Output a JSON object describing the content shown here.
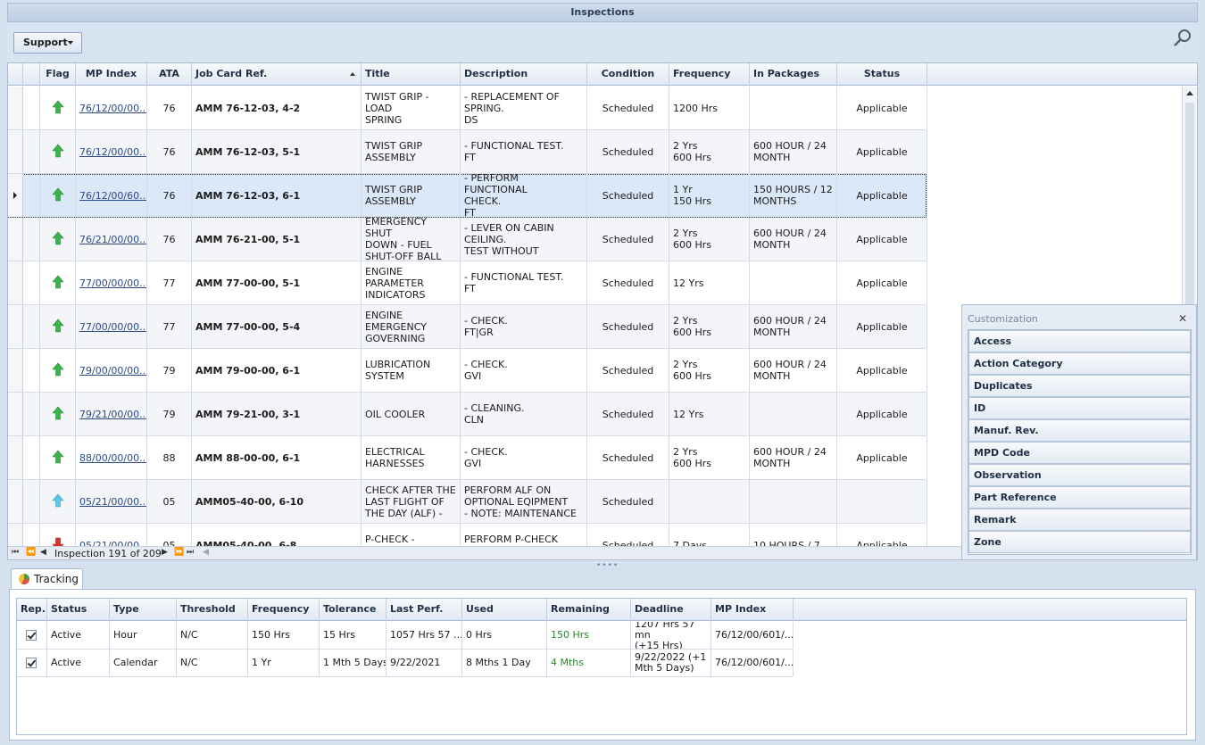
{
  "window": {
    "title": "Inspections"
  },
  "toolbar": {
    "support_label": "Support"
  },
  "grid": {
    "columns": [
      "Flag",
      "MP Index",
      "ATA",
      "Job Card Ref.",
      "Title",
      "Description",
      "Condition",
      "Frequency",
      "In Packages",
      "Status"
    ],
    "rows": [
      {
        "flag": "up-green",
        "mp_index": "76/12/00/00...",
        "ata": "76",
        "job_card": "AMM 76-12-03, 4-2",
        "title": "TWIST GRIP - LOAD\nSPRING",
        "description": "- REPLACEMENT OF\nSPRING.\nDS",
        "condition": "Scheduled",
        "frequency": "1200 Hrs",
        "packages": "",
        "status": "Applicable"
      },
      {
        "flag": "up-green",
        "mp_index": "76/12/00/00...",
        "ata": "76",
        "job_card": "AMM 76-12-03, 5-1",
        "title": "TWIST GRIP\nASSEMBLY",
        "description": "- FUNCTIONAL TEST.\nFT",
        "condition": "Scheduled",
        "frequency": "2 Yrs\n600 Hrs",
        "packages": "600 HOUR / 24\nMONTH",
        "status": "Applicable"
      },
      {
        "flag": "up-green",
        "mp_index": "76/12/00/60...",
        "ata": "76",
        "job_card": "AMM 76-12-03, 6-1",
        "title": "TWIST GRIP\nASSEMBLY",
        "description": "- PERFORM FUNCTIONAL\nCHECK.\nFT",
        "condition": "Scheduled",
        "frequency": "1 Yr\n150 Hrs",
        "packages": "150 HOURS / 12\nMONTHS",
        "status": "Applicable"
      },
      {
        "flag": "up-green",
        "mp_index": "76/21/00/00...",
        "ata": "76",
        "job_card": "AMM 76-21-00, 5-1",
        "title": "EMERGENCY SHUT\nDOWN - FUEL\nSHUT-OFF BALL",
        "description": "- LEVER ON CABIN\nCEILING.\nTEST WITHOUT",
        "condition": "Scheduled",
        "frequency": "2 Yrs\n600 Hrs",
        "packages": "600 HOUR / 24\nMONTH",
        "status": "Applicable"
      },
      {
        "flag": "up-green",
        "mp_index": "77/00/00/00...",
        "ata": "77",
        "job_card": "AMM 77-00-00, 5-1",
        "title": "ENGINE\nPARAMETER\nINDICATORS",
        "description": "- FUNCTIONAL TEST.\nFT",
        "condition": "Scheduled",
        "frequency": "12 Yrs",
        "packages": "",
        "status": "Applicable"
      },
      {
        "flag": "up-green",
        "mp_index": "77/00/00/00...",
        "ata": "77",
        "job_card": "AMM 77-00-00, 5-4",
        "title": "ENGINE\nEMERGENCY\nGOVERNING",
        "description": "- CHECK.\nFT|GR",
        "condition": "Scheduled",
        "frequency": "2 Yrs\n600 Hrs",
        "packages": "600 HOUR / 24\nMONTH",
        "status": "Applicable"
      },
      {
        "flag": "up-green",
        "mp_index": "79/00/00/00...",
        "ata": "79",
        "job_card": "AMM 79-00-00, 6-1",
        "title": "LUBRICATION\nSYSTEM",
        "description": "- CHECK.\nGVI",
        "condition": "Scheduled",
        "frequency": "2 Yrs\n600 Hrs",
        "packages": "600 HOUR / 24\nMONTH",
        "status": "Applicable"
      },
      {
        "flag": "up-green",
        "mp_index": "79/21/00/00...",
        "ata": "79",
        "job_card": "AMM 79-21-00, 3-1",
        "title": "OIL COOLER",
        "description": "- CLEANING.\nCLN",
        "condition": "Scheduled",
        "frequency": "12 Yrs",
        "packages": "",
        "status": "Applicable"
      },
      {
        "flag": "up-green",
        "mp_index": "88/00/00/00...",
        "ata": "88",
        "job_card": "AMM 88-00-00, 6-1",
        "title": "ELECTRICAL\nHARNESSES",
        "description": "- CHECK.\nGVI",
        "condition": "Scheduled",
        "frequency": "2 Yrs\n600 Hrs",
        "packages": "600 HOUR / 24\nMONTH",
        "status": "Applicable"
      },
      {
        "flag": "up-blue",
        "mp_index": "05/21/00/00...",
        "ata": "05",
        "job_card": "AMM05-40-00, 6-10",
        "title": "CHECK AFTER THE\nLAST FLIGHT OF\nTHE DAY (ALF) -",
        "description": "PERFORM ALF ON\nOPTIONAL EQIPMENT\n- NOTE: MAINTENANCE",
        "condition": "Scheduled",
        "frequency": "",
        "packages": "",
        "status": ""
      },
      {
        "flag": "down-red",
        "mp_index": "05/21/00/00...",
        "ata": "05",
        "job_card": "AMM05-40-00, 6-8",
        "title": "P-CHECK -\nOPTIONAL",
        "description": "PERFORM P-CHECK\nOPTIONAL EQUIPMENTS",
        "condition": "Scheduled",
        "frequency": "7 Days",
        "packages": "10 HOURS / 7",
        "status": "Applicable"
      }
    ],
    "selected_row": 2,
    "navigator": "Inspection 191 of 209"
  },
  "customization": {
    "title": "Customization",
    "items": [
      "Access",
      "Action Category",
      "Duplicates",
      "ID",
      "Manuf. Rev.",
      "MPD Code",
      "Observation",
      "Part Reference",
      "Remark",
      "Zone"
    ]
  },
  "tracking": {
    "tab_label": "Tracking",
    "columns": [
      "Rep.",
      "Status",
      "Type",
      "Threshold",
      "Frequency",
      "Tolerance",
      "Last Perf.",
      "Used",
      "Remaining",
      "Deadline",
      "MP Index"
    ],
    "rows": [
      {
        "status": "Active",
        "type": "Hour",
        "threshold": "N/C",
        "frequency": "150 Hrs",
        "tolerance": "15 Hrs",
        "last_perf": "1057 Hrs 57 ...",
        "used": "0 Hrs",
        "remaining": "150 Hrs",
        "deadline": "1207 Hrs 57 mn\n(+15 Hrs)",
        "mp_index": "76/12/00/601/..."
      },
      {
        "status": "Active",
        "type": "Calendar",
        "threshold": "N/C",
        "frequency": "1 Yr",
        "tolerance": "1 Mth 5 Days",
        "last_perf": "9/22/2021",
        "used": "8 Mths 1 Day",
        "remaining": "4 Mths",
        "deadline": "9/22/2022 (+1\nMth 5 Days)",
        "mp_index": "76/12/00/601/..."
      }
    ]
  }
}
